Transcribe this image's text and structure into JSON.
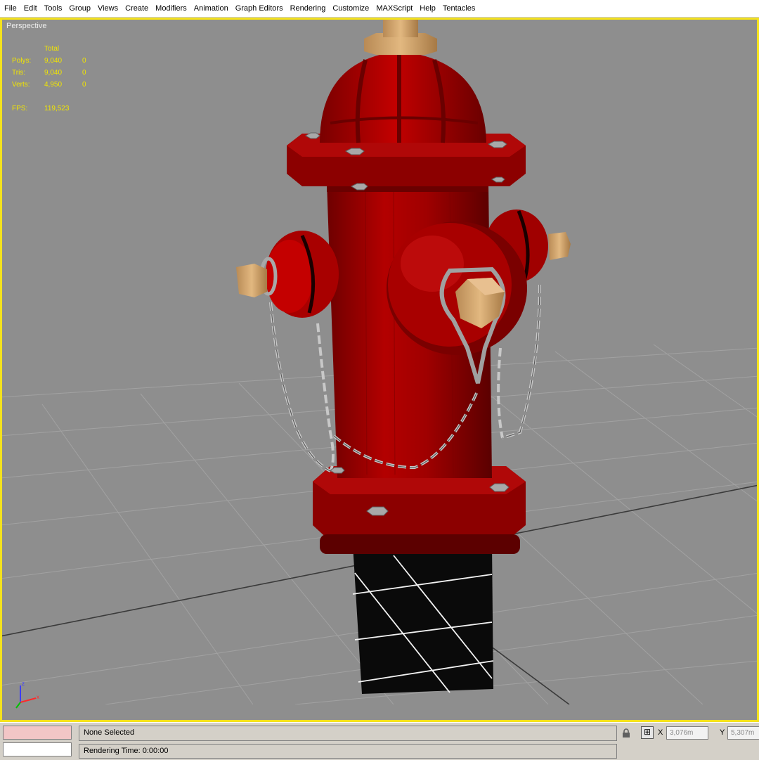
{
  "menu": [
    "File",
    "Edit",
    "Tools",
    "Group",
    "Views",
    "Create",
    "Modifiers",
    "Animation",
    "Graph Editors",
    "Rendering",
    "Customize",
    "MAXScript",
    "Help",
    "Tentacles"
  ],
  "viewport": {
    "label": "Perspective",
    "stats": {
      "header": "Total",
      "rows": [
        {
          "label": "Polys:",
          "total": "9,040",
          "selected": "0"
        },
        {
          "label": "Tris:",
          "total": "9,040",
          "selected": "0"
        },
        {
          "label": "Verts:",
          "total": "4,950",
          "selected": "0"
        }
      ],
      "fps_label": "FPS:",
      "fps_value": "119,523"
    },
    "stats_color": "#f2e600",
    "border_color": "#f4e21c",
    "background_color": "#8e8e8e"
  },
  "status": {
    "selection": "None Selected",
    "prompt": "Rendering Time: 0:00:00",
    "x_label": "X",
    "x_value": "3,076m",
    "y_label": "Y",
    "y_value": "5,307m"
  },
  "icons": {
    "lock": "lock-icon",
    "abs_mode": "absolute-mode-icon",
    "axis": "axis-tripod-icon"
  }
}
